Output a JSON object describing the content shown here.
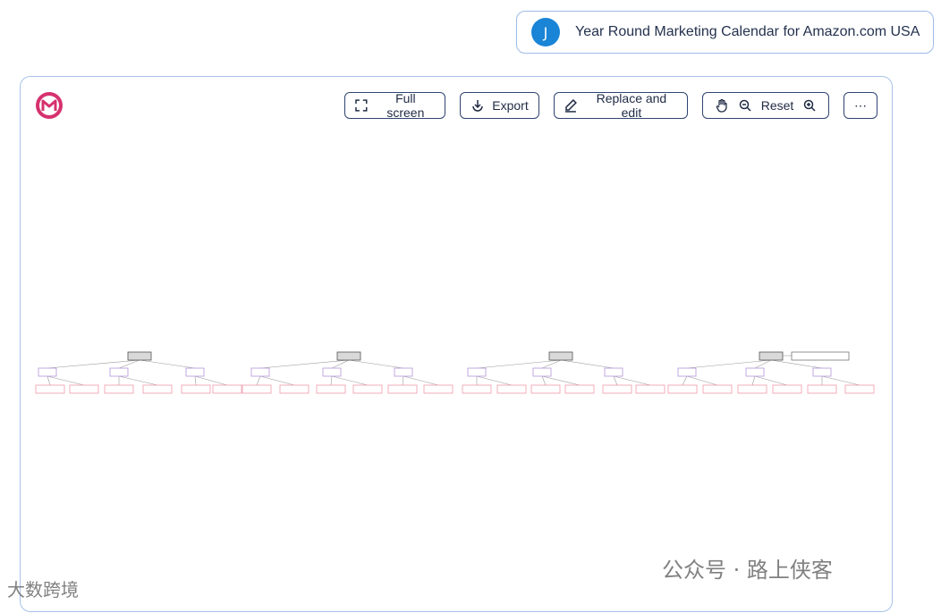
{
  "user": {
    "initial": "J",
    "title": "Year Round Marketing Calendar for Amazon.com USA"
  },
  "toolbar": {
    "fullscreen_label": "Full screen",
    "export_label": "Export",
    "replace_label": "Replace and edit",
    "reset_label": "Reset",
    "more_label": "⋯"
  },
  "colors": {
    "accent_border": "#a9c1ea",
    "button_border": "#2f4470",
    "avatar": "#1a84d6",
    "logo": "#d6326f",
    "root_fill": "#d9d9d9",
    "mid_border": "#b493d9",
    "leaf_border": "#f09aa8"
  },
  "mindmap": {
    "groups": [
      {
        "branches": 3,
        "leaves_per_branch": 2
      },
      {
        "branches": 3,
        "leaves_per_branch": 2
      },
      {
        "branches": 3,
        "leaves_per_branch": 2
      },
      {
        "branches": 3,
        "leaves_per_branch": 2
      }
    ],
    "has_note_node": true
  },
  "watermarks": {
    "left": "大数跨境",
    "right": "公众号 · 路上侠客"
  }
}
